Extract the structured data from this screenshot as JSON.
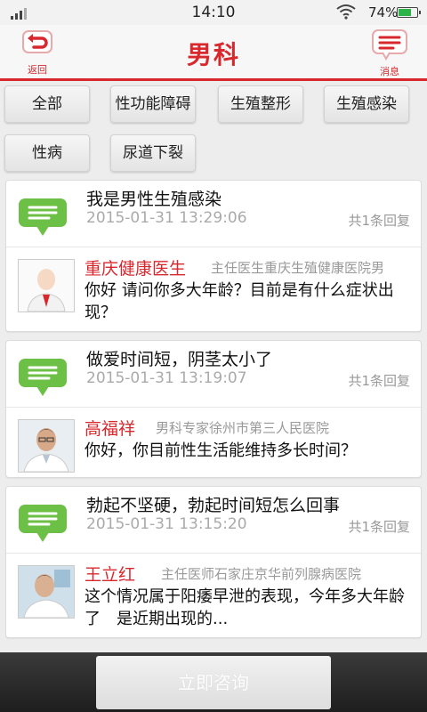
{
  "status_bar": {
    "time": "14:10",
    "battery": "74%",
    "battery_level": 0.74
  },
  "header": {
    "back_label": "返回",
    "title": "男科",
    "messages_label": "消息"
  },
  "colors": {
    "accent": "#d8282e",
    "bubble": "#6cc045"
  },
  "categories": [
    "全部",
    "性功能障碍",
    "生殖整形",
    "生殖感染",
    "性病",
    "尿道下裂"
  ],
  "questions": [
    {
      "title": "我是男性生殖感染",
      "date": "2015-01-31 13:29:06",
      "replies": "共1条回复",
      "doctor_name": "重庆健康医生",
      "doctor_title": "主任医生重庆生殖健康医院男",
      "answer": "你好 请问你多大年龄？目前是有什么症状出现？"
    },
    {
      "title": "做爱时间短，阴茎太小了",
      "date": "2015-01-31 13:19:07",
      "replies": "共1条回复",
      "doctor_name": "高福祥",
      "doctor_title": "男科专家徐州市第三人民医院",
      "answer": "你好，你目前性生活能维持多长时间？"
    },
    {
      "title": "勃起不坚硬，勃起时间短怎么回事",
      "date": "2015-01-31 13:15:20",
      "replies": "共1条回复",
      "doctor_name": "王立红",
      "doctor_title": "主任医师石家庄京华前列腺病医院",
      "answer": "这个情况属于阳痿早泄的表现，今年多大年龄了　是近期出现的..."
    }
  ],
  "bottom": {
    "consult_label": "立即咨询"
  }
}
